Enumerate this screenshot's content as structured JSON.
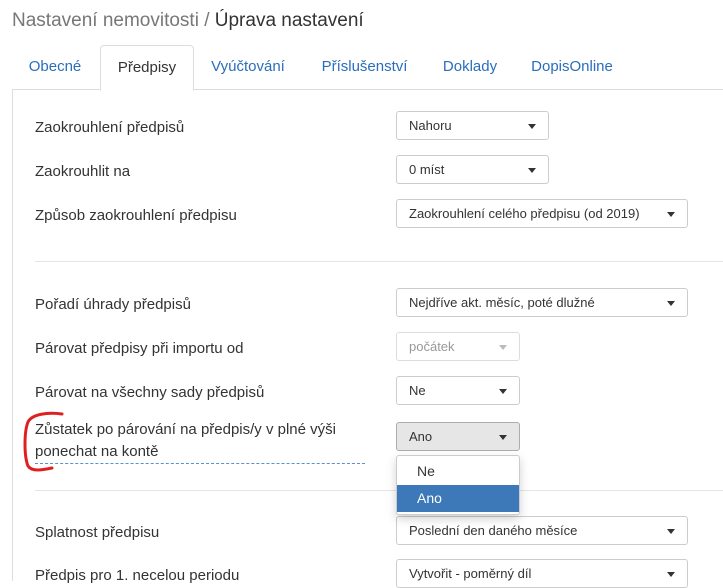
{
  "header": {
    "parent": "Nastavení nemovitosti",
    "separator": "/",
    "current": "Úprava nastavení"
  },
  "tabs": [
    {
      "label": "Obecné"
    },
    {
      "label": "Předpisy"
    },
    {
      "label": "Vyúčtování"
    },
    {
      "label": "Příslušenství"
    },
    {
      "label": "Doklady"
    },
    {
      "label": "DopisOnline"
    }
  ],
  "active_tab": "Předpisy",
  "settings": [
    {
      "label": "Zaokrouhlení předpisů",
      "value": "Nahoru"
    },
    {
      "label": "Zaokrouhlit na",
      "value": "0 míst"
    },
    {
      "label": "Způsob zaokrouhlení předpisu",
      "value": "Zaokrouhlení celého předpisu (od 2019)"
    },
    {
      "label": "Pořadí úhrady předpisů",
      "value": "Nejdříve akt. měsíc, poté dlužné"
    },
    {
      "label": "Párovat předpisy při importu od",
      "value": "počátek"
    },
    {
      "label": "Párovat na všechny sady předpisů",
      "value": "Ne"
    },
    {
      "label": "Zůstatek po párování na předpis/y v plné výši ponechat na kontě",
      "value": "Ano"
    },
    {
      "label": "Splatnost předpisu",
      "value": "Poslední den daného měsíce"
    },
    {
      "label": "Předpis pro 1. necelou periodu",
      "value": "Vytvořit - poměrný díl"
    }
  ],
  "open_dropdown": {
    "options": [
      "Ne",
      "Ano"
    ],
    "selected": "Ano"
  },
  "colors": {
    "link": "#2a6ebb",
    "selected_option": "#3d79b8",
    "annotation": "#e02020"
  }
}
